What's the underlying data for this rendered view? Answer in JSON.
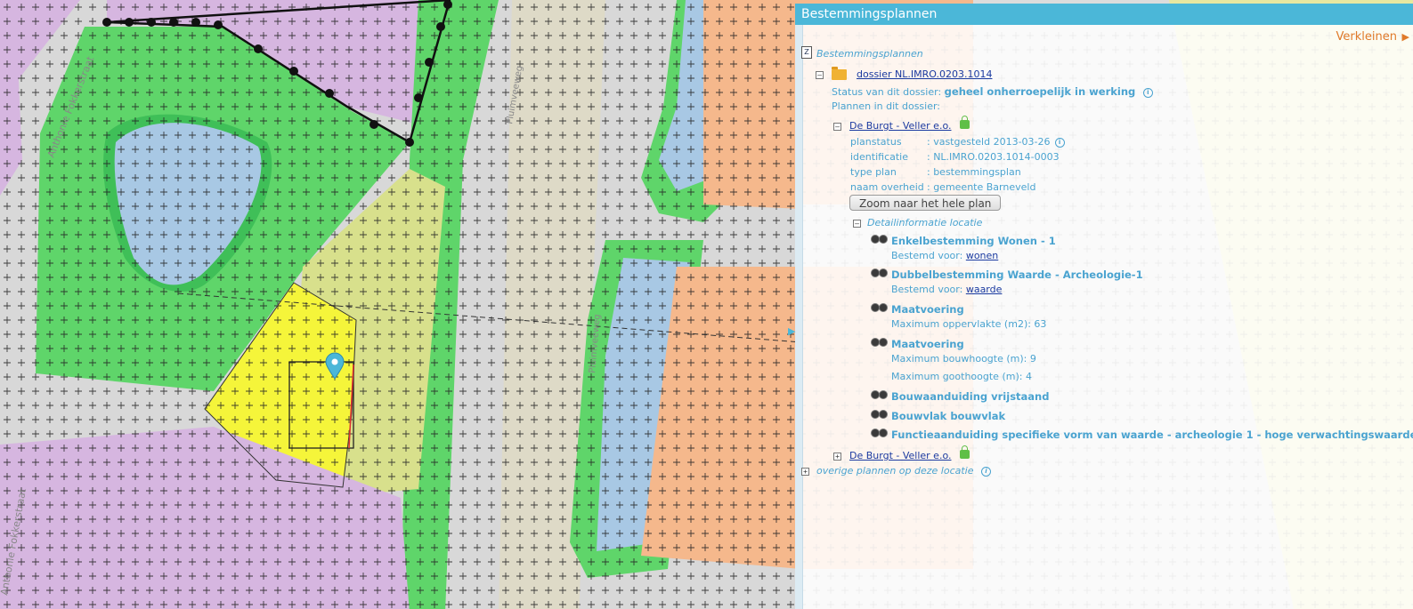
{
  "panel": {
    "title": "Bestemmingsplannen",
    "shrink_label": "Verkleinen"
  },
  "tree": {
    "root_label": "Bestemmingsplannen",
    "dossier_link": "dossier NL.IMRO.0203.1014",
    "status_label": "Status van dit dossier:",
    "status_value": "geheel onherroepelijk in werking",
    "plans_label": "Plannen in dit dossier:",
    "plan1": {
      "name": "De Burgt - Veller e.o.",
      "fields": [
        {
          "key": "planstatus",
          "value": ": vastgesteld 2013-03-26"
        },
        {
          "key": "identificatie",
          "value": ": NL.IMRO.0203.1014-0003"
        },
        {
          "key": "type plan",
          "value": ": bestemmingsplan"
        },
        {
          "key": "naam overheid",
          "value": ": gemeente Barneveld"
        }
      ],
      "zoom_button": "Zoom naar het hele plan",
      "detail_label": "Detailinformatie locatie",
      "details": [
        {
          "title": "Enkelbestemming Wonen - 1",
          "sub_label": "Bestemd voor:",
          "sub_link": "wonen"
        },
        {
          "title": "Dubbelbestemming Waarde - Archeologie-1",
          "sub_label": "Bestemd voor:",
          "sub_link": "waarde"
        },
        {
          "title": "Maatvoering",
          "sub_label": "Maximum oppervlakte (m2): 63"
        },
        {
          "title": "Maatvoering",
          "sub_label": "Maximum bouwhoogte (m): 9",
          "sub_label2": "Maximum goothoogte (m): 4"
        },
        {
          "title": "Bouwaanduiding vrijstaand"
        },
        {
          "title": "Bouwvlak bouwvlak"
        },
        {
          "title": "Functieaanduiding specifieke vorm van waarde - archeologie 1 - hoge verwachtingswaarde"
        }
      ]
    },
    "plan2_name": "De Burgt - Veller e.o.",
    "other_plans": "overige plannen op deze locatie"
  },
  "map": {
    "street_labels": [
      "Anthonie Fokkerstraat",
      "Anthonie Fokkerstraat",
      "Pluimveeweg",
      "Pluimveeweg"
    ],
    "colors": {
      "residential": "#d6b6e0",
      "green": "#5fd56a",
      "water": "#a8c8e4",
      "road": "#d8d8d8",
      "mixed": "#d8e08c",
      "selected": "#f5f53a",
      "commercial": "#f5b88c",
      "accent": "#4bb7d8"
    }
  }
}
